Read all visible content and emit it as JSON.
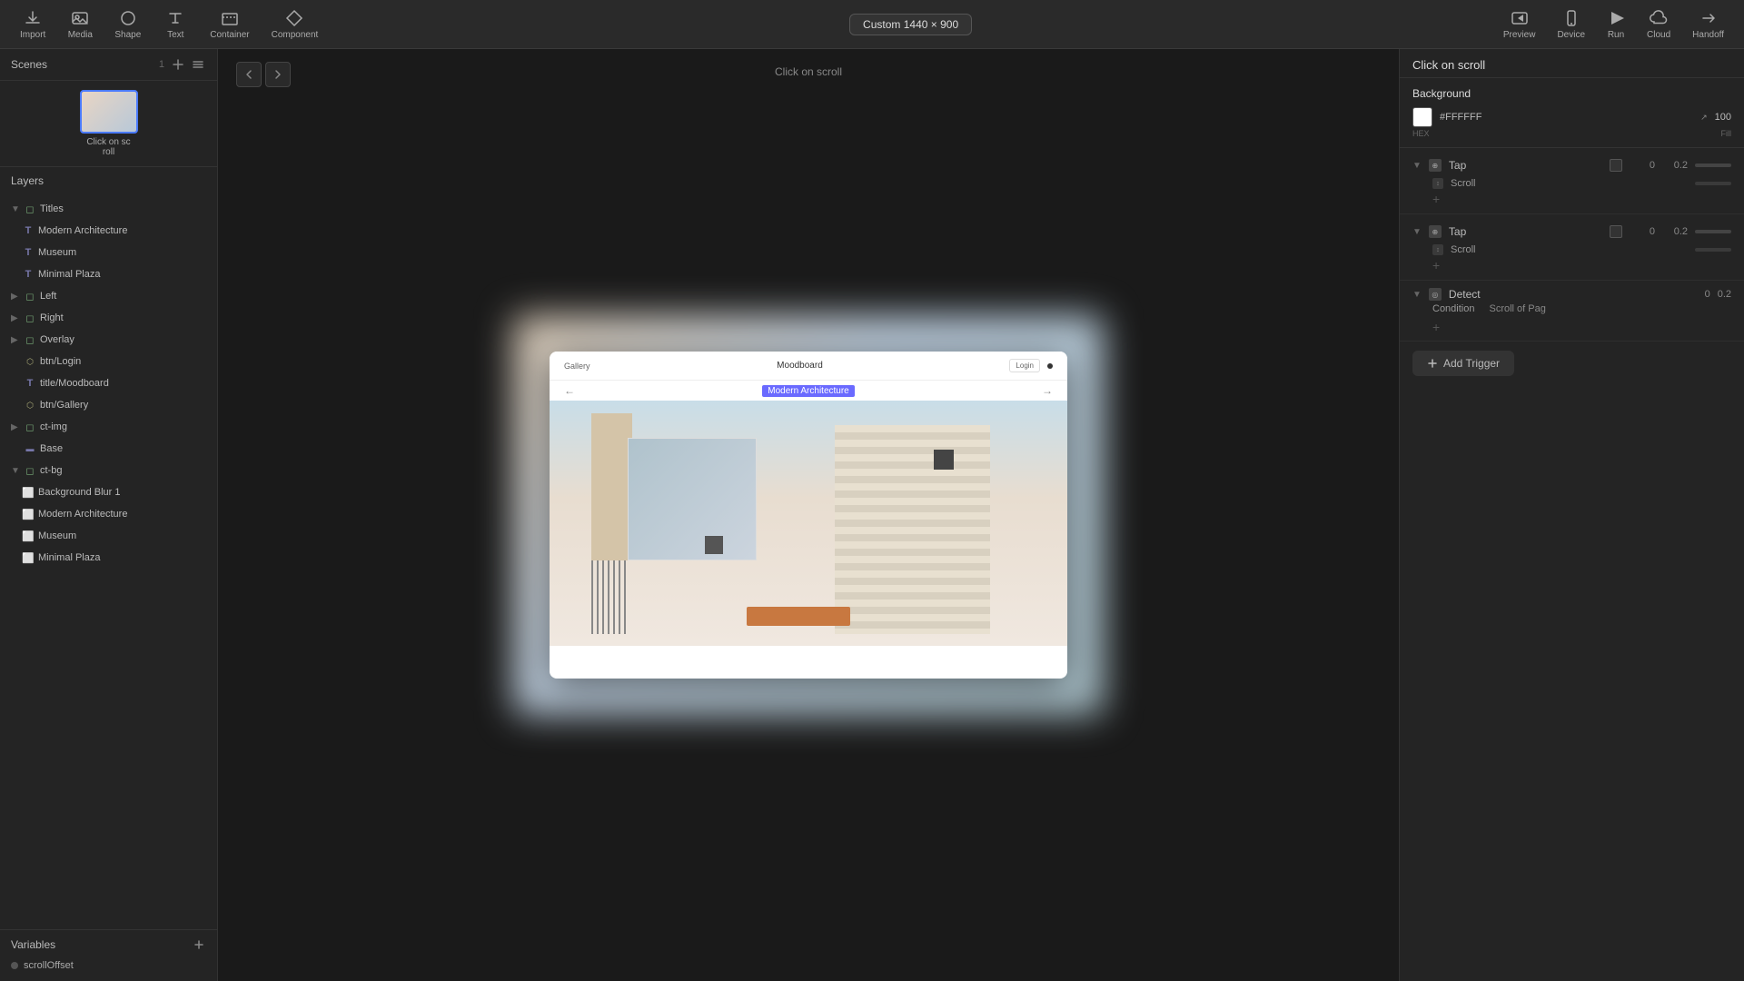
{
  "toolbar": {
    "import_label": "Import",
    "media_label": "Media",
    "shape_label": "Shape",
    "text_label": "Text",
    "container_label": "Container",
    "component_label": "Component",
    "resolution": "Custom 1440 × 900",
    "preview_label": "Preview",
    "device_label": "Device",
    "run_label": "Run",
    "cloud_label": "Cloud",
    "handoff_label": "Handoff"
  },
  "scenes": {
    "title": "Scenes",
    "count": "1",
    "thumbnail_label": "Click on sc roll"
  },
  "layers": {
    "title": "Layers",
    "items": [
      {
        "name": "Titles",
        "type": "group",
        "indent": 0,
        "expanded": true
      },
      {
        "name": "Modern Architecture",
        "type": "text",
        "indent": 1
      },
      {
        "name": "Museum",
        "type": "text",
        "indent": 1
      },
      {
        "name": "Minimal Plaza",
        "type": "text",
        "indent": 1
      },
      {
        "name": "Left",
        "type": "group",
        "indent": 0,
        "expanded": false
      },
      {
        "name": "Right",
        "type": "group",
        "indent": 0,
        "expanded": false
      },
      {
        "name": "Overlay",
        "type": "group",
        "indent": 0,
        "expanded": false
      },
      {
        "name": "btn/Login",
        "type": "component",
        "indent": 0
      },
      {
        "name": "title/Moodboard",
        "type": "text",
        "indent": 0
      },
      {
        "name": "btn/Gallery",
        "type": "component",
        "indent": 0
      },
      {
        "name": "ct-img",
        "type": "group",
        "indent": 0,
        "expanded": false
      },
      {
        "name": "Base",
        "type": "rect",
        "indent": 0
      },
      {
        "name": "ct-bg",
        "type": "group",
        "indent": 0,
        "expanded": true
      },
      {
        "name": "Background Blur 1",
        "type": "img",
        "indent": 1
      },
      {
        "name": "Modern Architecture",
        "type": "img",
        "indent": 1
      },
      {
        "name": "Museum",
        "type": "img",
        "indent": 1
      },
      {
        "name": "Minimal Plaza",
        "type": "img",
        "indent": 1
      }
    ]
  },
  "variables": {
    "title": "Variables",
    "items": [
      {
        "name": "scrollOffset"
      }
    ]
  },
  "canvas": {
    "label": "Click on scroll",
    "nav_back": "←",
    "nav_forward": "→"
  },
  "mock_site": {
    "nav_gallery": "Gallery",
    "nav_title": "Moodboard",
    "nav_login": "Login",
    "slide_left": "←",
    "slide_right": "→",
    "slide_title": "Modern Architecture"
  },
  "right_panel": {
    "interaction_title": "Click on scroll",
    "triggers": [
      {
        "type": "Tap",
        "action": "Scroll",
        "num1": "0",
        "num2": "0.2"
      },
      {
        "type": "Tap",
        "action": "Scroll",
        "num1": "0",
        "num2": "0.2"
      }
    ],
    "detect": {
      "type": "Detect",
      "condition_label": "Condition",
      "condition_value": "Scroll of Pag",
      "num1": "0",
      "num2": "0.2"
    },
    "add_trigger_label": "Add Trigger"
  },
  "bg_panel": {
    "title": "Background",
    "hex": "#FFFFFF",
    "hex_label": "HEX",
    "opacity": "100",
    "fill_label": "Fill"
  }
}
